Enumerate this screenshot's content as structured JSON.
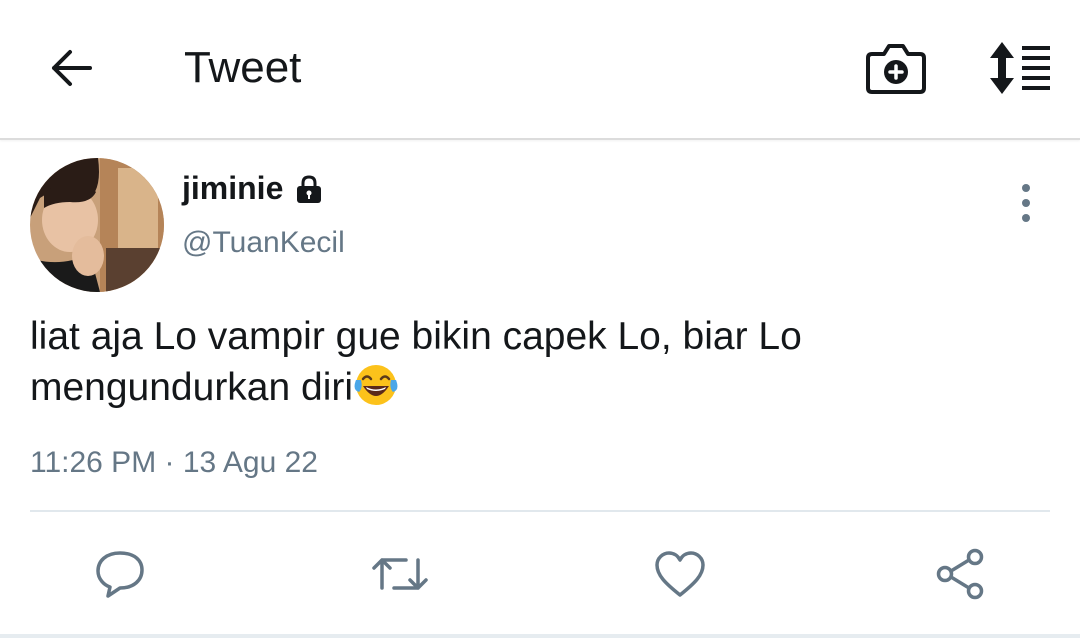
{
  "header": {
    "title": "Tweet",
    "back_icon": "arrow-left-icon",
    "camera_icon": "camera-plus-icon",
    "sort_icon": "sort-list-icon"
  },
  "tweet": {
    "author_name": "jiminie",
    "author_handle": "@TuanKecil",
    "protected_icon": "lock-icon",
    "text": "liat aja Lo vampir gue bikin capek Lo, biar Lo mengundurkan diri",
    "emoji": "face-with-tears-of-joy",
    "timestamp": "11:26 PM · 13 Agu 22"
  },
  "actions": [
    "reply-icon",
    "retweet-icon",
    "like-icon",
    "share-icon"
  ],
  "colors": {
    "text": "#14171a",
    "secondary": "#657786",
    "divider": "#e1e8ed"
  }
}
